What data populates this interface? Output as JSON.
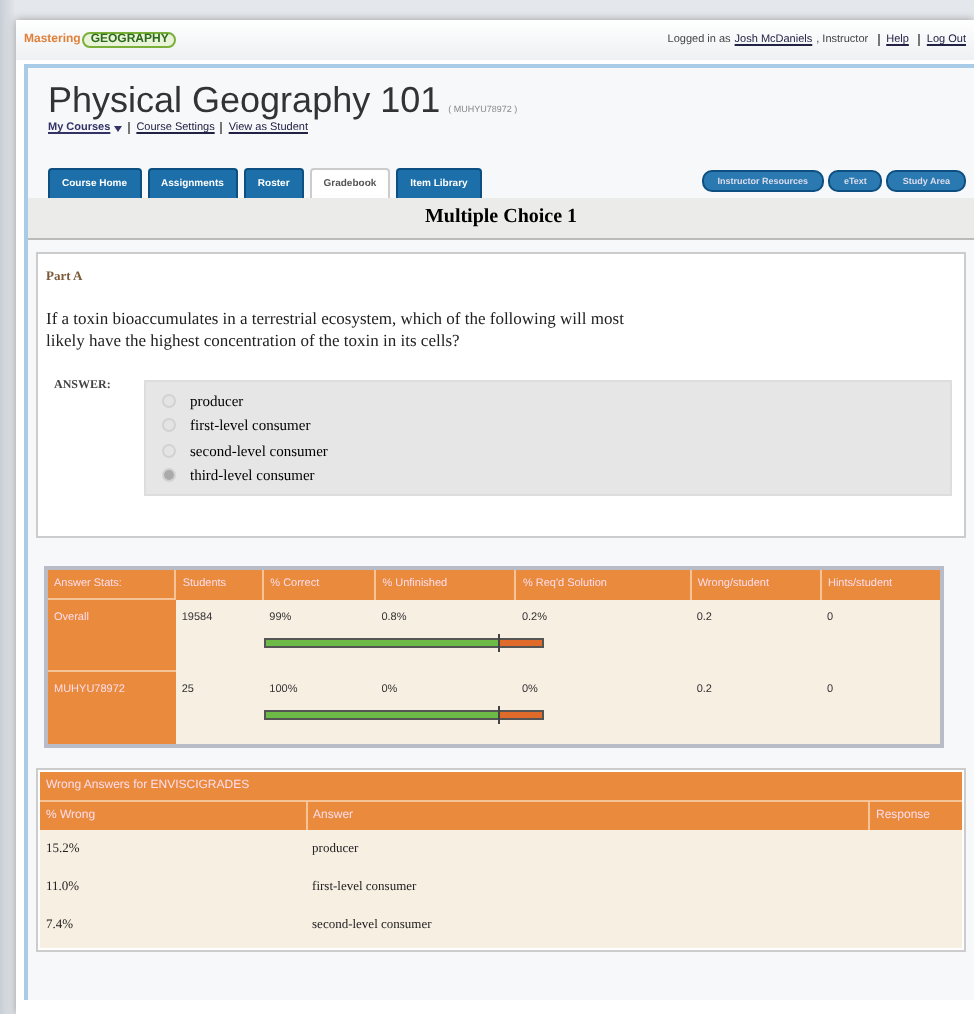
{
  "header": {
    "logo": {
      "prefix": "Mastering",
      "brand": "GEOGRAPHY"
    },
    "login_text": "Logged in as",
    "user": "Josh McDaniels",
    "role": ", Instructor",
    "links": [
      "Help",
      "Log Out"
    ]
  },
  "course": {
    "title": "Physical Geography 101",
    "code": "( MUHYU78972 )",
    "links": [
      "My Courses",
      "Course Settings",
      "View as Student"
    ]
  },
  "tabs": [
    {
      "label": "Course Home",
      "selected": false
    },
    {
      "label": "Assignments",
      "selected": false
    },
    {
      "label": "Roster",
      "selected": false
    },
    {
      "label": "Gradebook",
      "selected": true
    },
    {
      "label": "Item Library",
      "selected": false
    }
  ],
  "right_buttons": [
    "Instructor Resources",
    "eText",
    "Study Area"
  ],
  "assignment_title": "Multiple Choice 1",
  "part": {
    "label": "Part A",
    "question": "If a toxin bioaccumulates in a terrestrial ecosystem, which of the following will most likely have the highest concentration of the toxin in its cells?",
    "answer_label": "ANSWER:",
    "choices": [
      {
        "label": "producer",
        "selected": false
      },
      {
        "label": "first-level consumer",
        "selected": false
      },
      {
        "label": "second-level consumer",
        "selected": false
      },
      {
        "label": "third-level consumer",
        "selected": true
      }
    ]
  },
  "stats": {
    "columns": [
      "Answer Stats:",
      "Students",
      "% Correct",
      "% Unfinished",
      "% Req'd Solution",
      "Wrong/student",
      "Hints/student"
    ],
    "rows": [
      {
        "cells": [
          "Overall",
          "19584",
          "99%",
          "0.8%",
          "0.2%",
          "0.2",
          "0"
        ],
        "level": 0.84
      },
      {
        "cells": [
          "MUHYU78972",
          "25",
          "100%",
          "0%",
          "0%",
          "0.2",
          "0"
        ],
        "level": 0.84
      }
    ]
  },
  "wrong": {
    "title": "Wrong Answers for ENVISCIGRADES",
    "columns": [
      "% Wrong",
      "Answer",
      "Response"
    ],
    "rows": [
      [
        "15.2%",
        "producer"
      ],
      [
        "11.0%",
        "first-level consumer"
      ],
      [
        "7.4%",
        "second-level consumer"
      ]
    ]
  }
}
